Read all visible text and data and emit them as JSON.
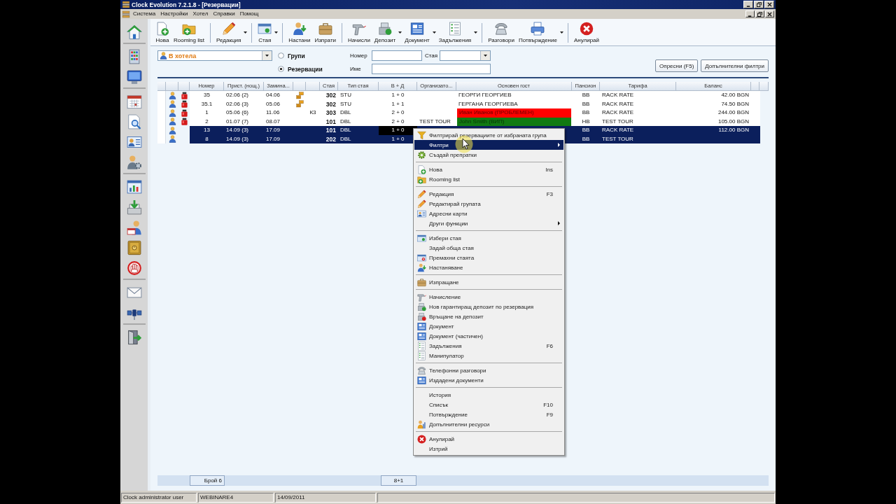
{
  "window": {
    "title": "Clock Evolution 7.2.1.8 - [Резервации]"
  },
  "menu_bar": [
    {
      "label": "Система"
    },
    {
      "label": "Настройки"
    },
    {
      "label": "Хотел"
    },
    {
      "label": "Справки"
    },
    {
      "label": "Помощ"
    }
  ],
  "toolbar": [
    {
      "kind": "button",
      "label": "Нова",
      "dropdown": false
    },
    {
      "kind": "button",
      "label": "Rooming list",
      "dropdown": false
    },
    {
      "kind": "separator"
    },
    {
      "kind": "button",
      "label": "Редакция",
      "dropdown": true
    },
    {
      "kind": "separator"
    },
    {
      "kind": "button",
      "label": "Стая",
      "dropdown": true
    },
    {
      "kind": "separator"
    },
    {
      "kind": "button",
      "label": "Настани",
      "dropdown": false
    },
    {
      "kind": "button",
      "label": "Изпрати",
      "dropdown": false
    },
    {
      "kind": "separator"
    },
    {
      "kind": "button",
      "label": "Начисли",
      "dropdown": false
    },
    {
      "kind": "button",
      "label": "Депозит",
      "dropdown": true
    },
    {
      "kind": "button",
      "label": "Документ",
      "dropdown": true
    },
    {
      "kind": "button",
      "label": "Задължения",
      "dropdown": true
    },
    {
      "kind": "separator"
    },
    {
      "kind": "button",
      "label": "Разговори",
      "dropdown": false
    },
    {
      "kind": "button",
      "label": "Потвърждение",
      "dropdown": true
    },
    {
      "kind": "separator"
    },
    {
      "kind": "button",
      "label": "Анулирай",
      "dropdown": false
    }
  ],
  "filters": {
    "scope": {
      "value": "В хотела"
    },
    "view_options": [
      {
        "label": "Групи",
        "selected": false
      },
      {
        "label": "Резервации",
        "selected": true
      }
    ],
    "fields": [
      {
        "kind": "text",
        "label": "Номер"
      },
      {
        "kind": "combo",
        "label": "Стая"
      },
      {
        "kind": "text",
        "label": "Име"
      }
    ],
    "buttons": [
      {
        "label": "Опресни (F5)"
      },
      {
        "label": "Допълнителни филтри"
      }
    ]
  },
  "table": {
    "columns": [
      "Номер",
      "Прист. (нощ.)",
      "Замина...",
      "Стая",
      "Тип стая",
      "В + Д",
      "Организато...",
      "Основен гост",
      "Пансион",
      "Тарифа",
      "Баланс"
    ],
    "rows": [
      {
        "alert": true,
        "group": true,
        "number": "35",
        "arrival": "02.06 (2)",
        "departure": "04.06",
        "room": "302",
        "room_type": "STU",
        "guests": "1 + 0",
        "guest": {
          "name": "ГЕОРГИ ГЕОРГИЕВ"
        },
        "board": "BB",
        "rate": "RACK RATE",
        "balance": "42.00 BGN",
        "selected": false,
        "focused": false
      },
      {
        "alert": true,
        "group": true,
        "number": "35.1",
        "arrival": "02.06 (3)",
        "departure": "05.06",
        "room": "302",
        "room_type": "STU",
        "guests": "1 + 1",
        "guest": {
          "name": "ГЕРГАНА ГЕОРГИЕВА"
        },
        "board": "BB",
        "rate": "RACK RATE",
        "balance": "74.50 BGN",
        "selected": false,
        "focused": false
      },
      {
        "alert": true,
        "group": false,
        "number": "1",
        "arrival": "05.06 (6)",
        "departure": "11.06",
        "column_8": "К3",
        "room": "303",
        "room_type": "DBL",
        "guests": "2 + 0",
        "guest": {
          "name": "Иван Иванов (ПРОБЛЕМЕН)",
          "color": "#ff0000"
        },
        "board": "BB",
        "rate": "RACK RATE",
        "balance": "244.00 BGN",
        "selected": false,
        "focused": false
      },
      {
        "alert": true,
        "group": false,
        "number": "2",
        "arrival": "01.07 (7)",
        "departure": "08.07",
        "room": "101",
        "room_type": "DBL",
        "guests": "2 + 0",
        "organizer": "TEST TOUR",
        "guest": {
          "name": "John Smith (ВИП)",
          "color": "#117a11"
        },
        "board": "HB",
        "rate": "TEST TOUR",
        "balance": "105.00 BGN",
        "selected": false,
        "focused": false
      },
      {
        "alert": false,
        "group": false,
        "number": "13",
        "arrival": "14.09 (3)",
        "departure": "17.09",
        "room": "101",
        "room_type": "DBL",
        "guests": "1 + 0",
        "board": "BB",
        "rate": "RACK RATE",
        "balance": "112.00 BGN",
        "selected": true,
        "focused": true
      },
      {
        "alert": false,
        "group": false,
        "number": "8",
        "arrival": "14.09 (3)",
        "departure": "17.09",
        "room": "202",
        "room_type": "DBL",
        "guests": "1 + 0",
        "board": "BB",
        "rate": "TEST TOUR",
        "selected": true,
        "focused": false
      }
    ]
  },
  "footer": {
    "count": "Брой 6",
    "guests_total": "8+1"
  },
  "context_menu": [
    {
      "kind": "item",
      "label": "Филтрирай резервациите от избраната група",
      "submenu": false,
      "selected": false
    },
    {
      "kind": "item",
      "label": "Филтри",
      "submenu": true,
      "selected": true
    },
    {
      "kind": "item",
      "label": "Създай препратки",
      "submenu": false,
      "selected": false
    },
    {
      "kind": "separator"
    },
    {
      "kind": "item",
      "label": "Нова",
      "shortcut": "Ins",
      "submenu": false,
      "selected": false
    },
    {
      "kind": "item",
      "label": "Rooming list",
      "submenu": false,
      "selected": false
    },
    {
      "kind": "separator"
    },
    {
      "kind": "item",
      "label": "Редакция",
      "shortcut": "F3",
      "submenu": false,
      "selected": false
    },
    {
      "kind": "item",
      "label": "Редактирай групата",
      "submenu": false,
      "selected": false
    },
    {
      "kind": "item",
      "label": "Адресни карти",
      "submenu": false,
      "selected": false
    },
    {
      "kind": "item",
      "label": "Други функции",
      "submenu": true,
      "selected": false
    },
    {
      "kind": "separator"
    },
    {
      "kind": "item",
      "label": "Избери стая",
      "submenu": false,
      "selected": false
    },
    {
      "kind": "item",
      "label": "Задай обща стая",
      "submenu": false,
      "selected": false
    },
    {
      "kind": "item",
      "label": "Премахни стаята",
      "submenu": false,
      "selected": false
    },
    {
      "kind": "item",
      "label": "Настаняване",
      "submenu": false,
      "selected": false
    },
    {
      "kind": "separator"
    },
    {
      "kind": "item",
      "label": "Изпращане",
      "submenu": false,
      "selected": false
    },
    {
      "kind": "separator"
    },
    {
      "kind": "item",
      "label": "Начисление",
      "submenu": false,
      "selected": false
    },
    {
      "kind": "item",
      "label": "Нов гарантиращ депозит по резервация",
      "submenu": false,
      "selected": false
    },
    {
      "kind": "item",
      "label": "Връщане на депозит",
      "submenu": false,
      "selected": false
    },
    {
      "kind": "item",
      "label": "Документ",
      "submenu": false,
      "selected": false
    },
    {
      "kind": "item",
      "label": "Документ (частичен)",
      "submenu": false,
      "selected": false
    },
    {
      "kind": "item",
      "label": "Задължения",
      "shortcut": "F6",
      "submenu": false,
      "selected": false
    },
    {
      "kind": "item",
      "label": "Манипулатор",
      "submenu": false,
      "selected": false
    },
    {
      "kind": "separator"
    },
    {
      "kind": "item",
      "label": "Телефонни разговори",
      "submenu": false,
      "selected": false
    },
    {
      "kind": "item",
      "label": "Издадени документи",
      "submenu": false,
      "selected": false
    },
    {
      "kind": "separator"
    },
    {
      "kind": "item",
      "label": "История",
      "submenu": false,
      "selected": false
    },
    {
      "kind": "item",
      "label": "Списък",
      "shortcut": "F10",
      "submenu": false,
      "selected": false
    },
    {
      "kind": "item",
      "label": "Потвърждение",
      "shortcut": "F9",
      "submenu": false,
      "selected": false
    },
    {
      "kind": "item",
      "label": "Допълнителни ресурси",
      "submenu": false,
      "selected": false
    },
    {
      "kind": "separator"
    },
    {
      "kind": "item",
      "label": "Анулирай",
      "submenu": false,
      "selected": false
    },
    {
      "kind": "item",
      "label": "Изтрий",
      "submenu": false,
      "selected": false
    }
  ],
  "status_bar": [
    "Clock administrator user",
    "WEBINARE4",
    "14/09/2011"
  ]
}
